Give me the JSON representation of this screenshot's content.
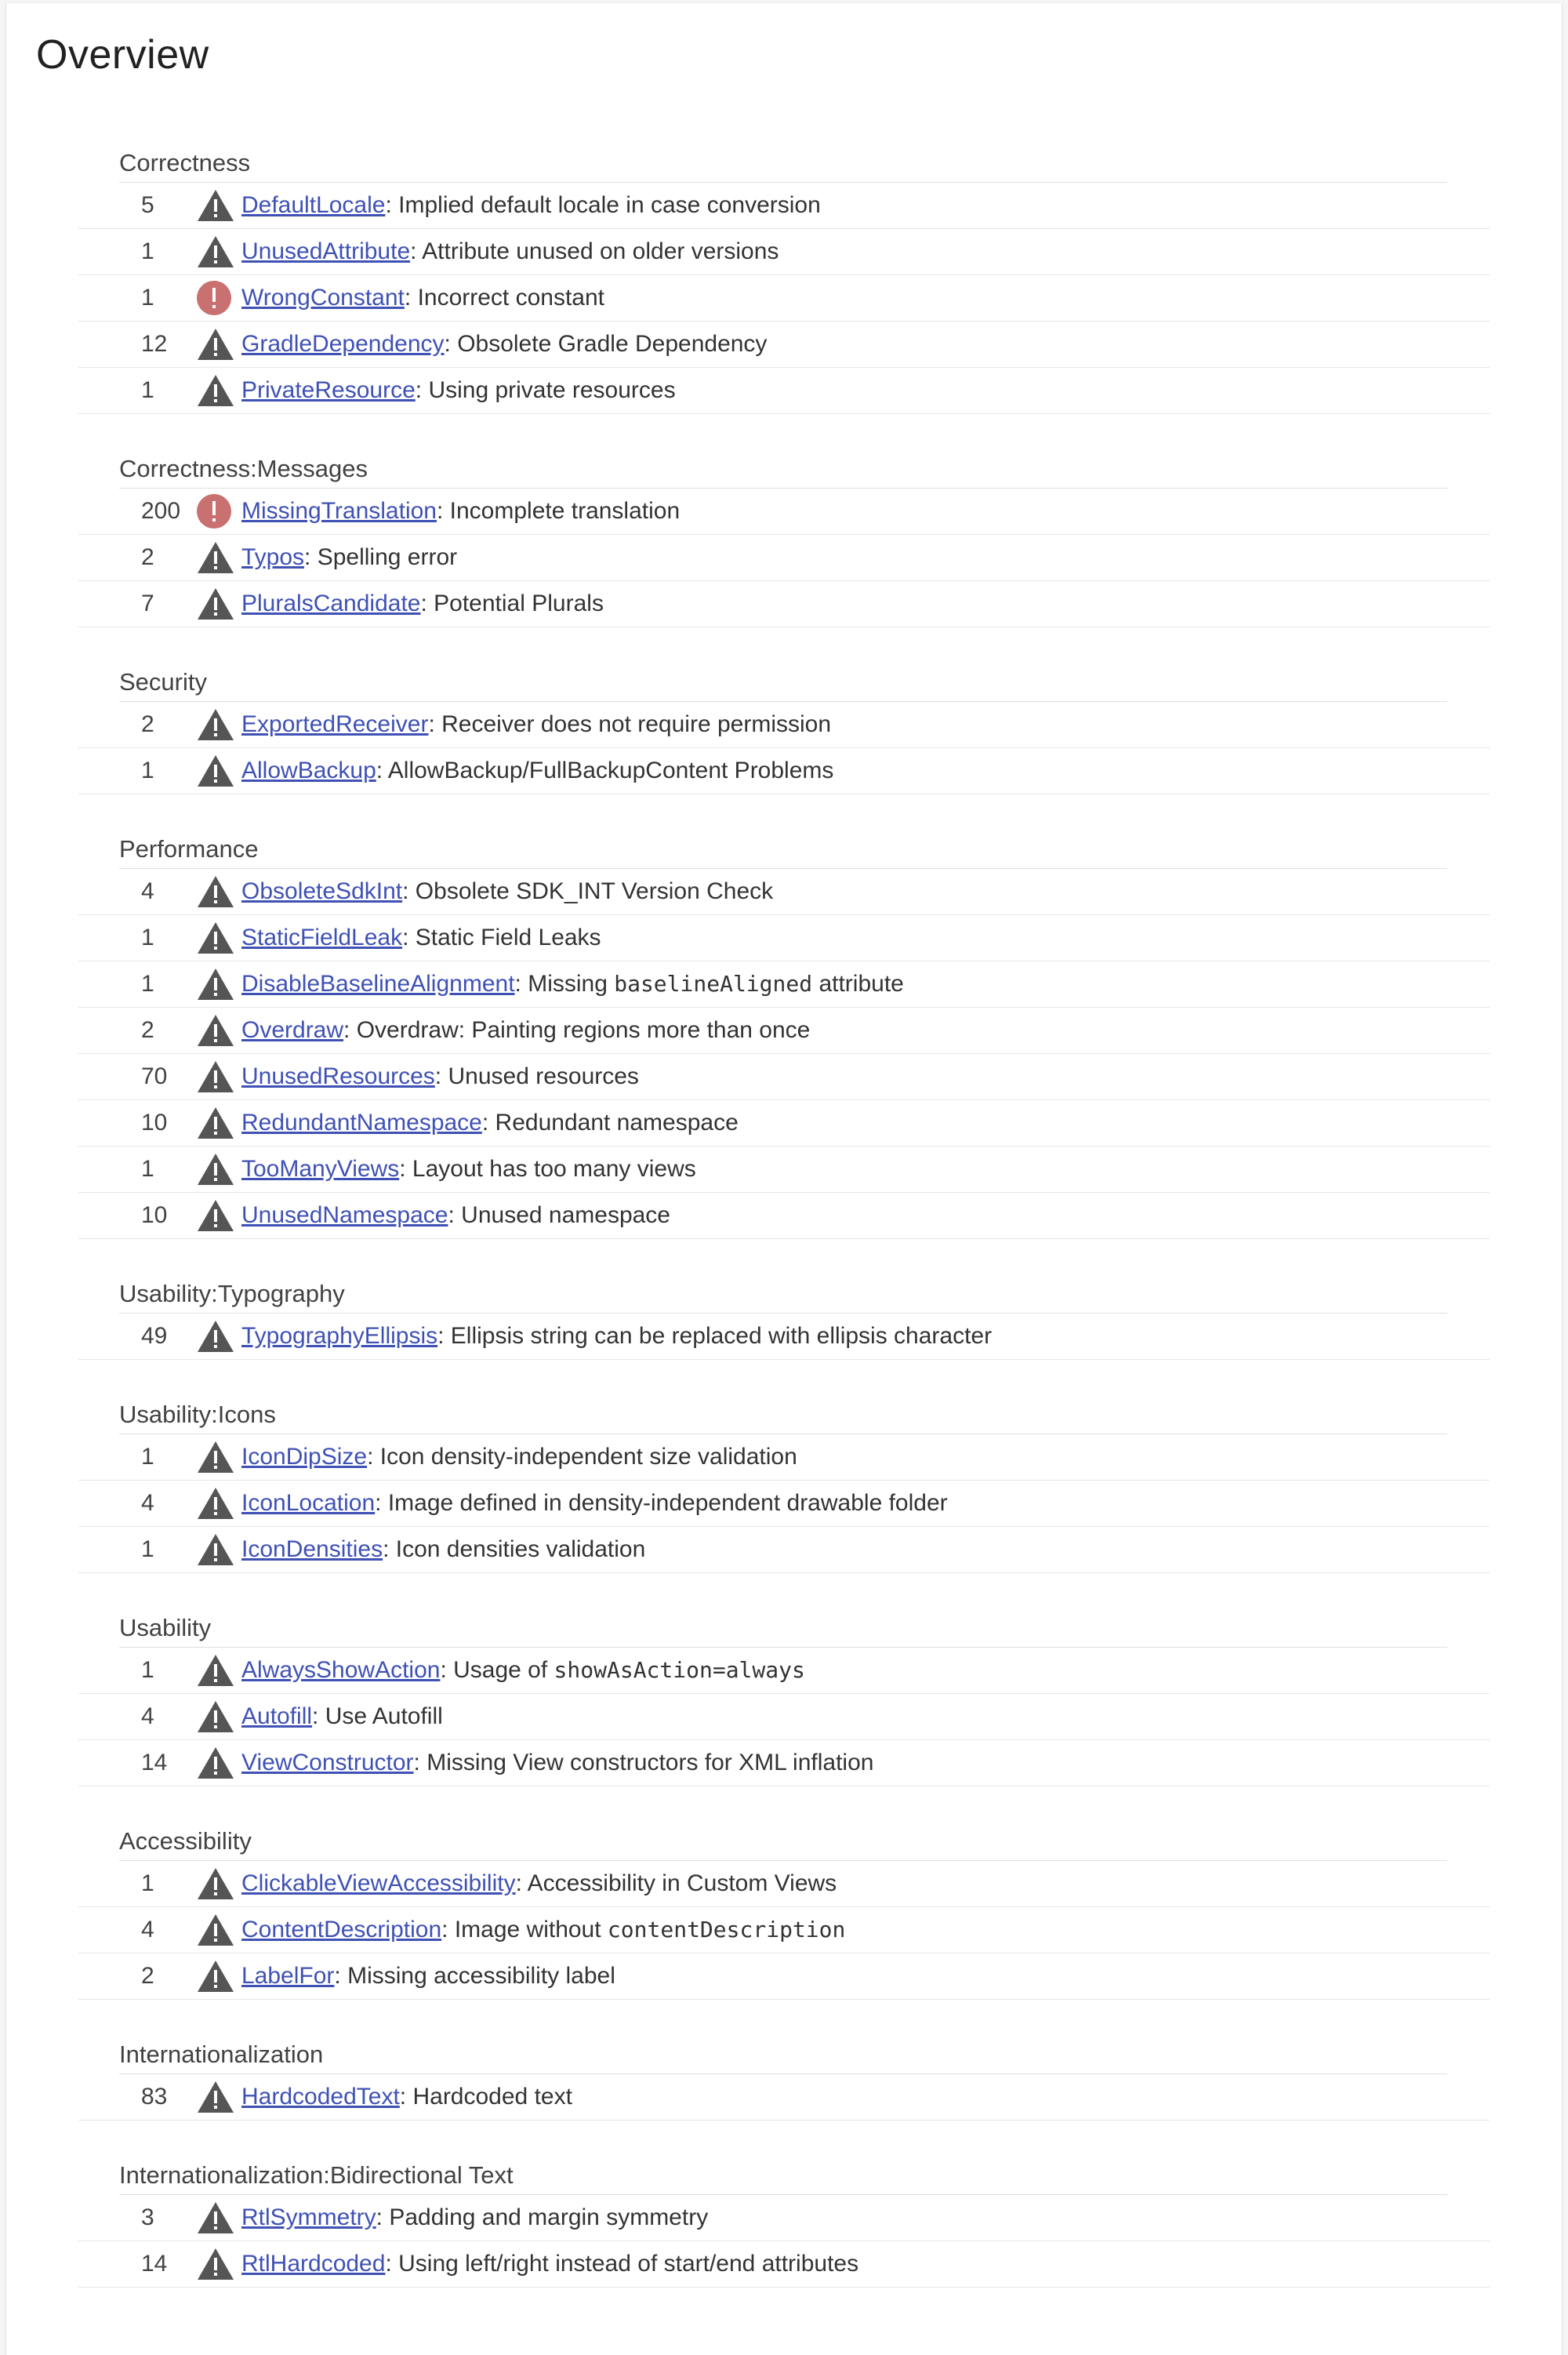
{
  "page": {
    "title": "Overview"
  },
  "sections": [
    {
      "title": "Correctness",
      "items": [
        {
          "count": "5",
          "severity": "warning",
          "id": "DefaultLocale",
          "description": "Implied default locale in case conversion"
        },
        {
          "count": "1",
          "severity": "warning",
          "id": "UnusedAttribute",
          "description": "Attribute unused on older versions"
        },
        {
          "count": "1",
          "severity": "error",
          "id": "WrongConstant",
          "description": "Incorrect constant"
        },
        {
          "count": "12",
          "severity": "warning",
          "id": "GradleDependency",
          "description": "Obsolete Gradle Dependency"
        },
        {
          "count": "1",
          "severity": "warning",
          "id": "PrivateResource",
          "description": "Using private resources"
        }
      ]
    },
    {
      "title": "Correctness:Messages",
      "items": [
        {
          "count": "200",
          "severity": "error",
          "id": "MissingTranslation",
          "description": "Incomplete translation"
        },
        {
          "count": "2",
          "severity": "warning",
          "id": "Typos",
          "description": "Spelling error"
        },
        {
          "count": "7",
          "severity": "warning",
          "id": "PluralsCandidate",
          "description": "Potential Plurals"
        }
      ]
    },
    {
      "title": "Security",
      "items": [
        {
          "count": "2",
          "severity": "warning",
          "id": "ExportedReceiver",
          "description": "Receiver does not require permission"
        },
        {
          "count": "1",
          "severity": "warning",
          "id": "AllowBackup",
          "description": "AllowBackup/FullBackupContent Problems"
        }
      ]
    },
    {
      "title": "Performance",
      "items": [
        {
          "count": "4",
          "severity": "warning",
          "id": "ObsoleteSdkInt",
          "description": "Obsolete SDK_INT Version Check"
        },
        {
          "count": "1",
          "severity": "warning",
          "id": "StaticFieldLeak",
          "description": "Static Field Leaks"
        },
        {
          "count": "1",
          "severity": "warning",
          "id": "DisableBaselineAlignment",
          "description": "Missing ",
          "code": "baselineAligned",
          "suffix": " attribute"
        },
        {
          "count": "2",
          "severity": "warning",
          "id": "Overdraw",
          "description": "Overdraw: Painting regions more than once"
        },
        {
          "count": "70",
          "severity": "warning",
          "id": "UnusedResources",
          "description": "Unused resources"
        },
        {
          "count": "10",
          "severity": "warning",
          "id": "RedundantNamespace",
          "description": "Redundant namespace"
        },
        {
          "count": "1",
          "severity": "warning",
          "id": "TooManyViews",
          "description": "Layout has too many views"
        },
        {
          "count": "10",
          "severity": "warning",
          "id": "UnusedNamespace",
          "description": "Unused namespace"
        }
      ]
    },
    {
      "title": "Usability:Typography",
      "items": [
        {
          "count": "49",
          "severity": "warning",
          "id": "TypographyEllipsis",
          "description": "Ellipsis string can be replaced with ellipsis character"
        }
      ]
    },
    {
      "title": "Usability:Icons",
      "items": [
        {
          "count": "1",
          "severity": "warning",
          "id": "IconDipSize",
          "description": "Icon density-independent size validation"
        },
        {
          "count": "4",
          "severity": "warning",
          "id": "IconLocation",
          "description": "Image defined in density-independent drawable folder"
        },
        {
          "count": "1",
          "severity": "warning",
          "id": "IconDensities",
          "description": "Icon densities validation"
        }
      ]
    },
    {
      "title": "Usability",
      "items": [
        {
          "count": "1",
          "severity": "warning",
          "id": "AlwaysShowAction",
          "description": "Usage of ",
          "code": "showAsAction=always",
          "suffix": ""
        },
        {
          "count": "4",
          "severity": "warning",
          "id": "Autofill",
          "description": "Use Autofill"
        },
        {
          "count": "14",
          "severity": "warning",
          "id": "ViewConstructor",
          "description": "Missing View constructors for XML inflation"
        }
      ]
    },
    {
      "title": "Accessibility",
      "items": [
        {
          "count": "1",
          "severity": "warning",
          "id": "ClickableViewAccessibility",
          "description": "Accessibility in Custom Views"
        },
        {
          "count": "4",
          "severity": "warning",
          "id": "ContentDescription",
          "description": "Image without ",
          "code": "contentDescription",
          "suffix": ""
        },
        {
          "count": "2",
          "severity": "warning",
          "id": "LabelFor",
          "description": "Missing accessibility label"
        }
      ]
    },
    {
      "title": "Internationalization",
      "items": [
        {
          "count": "83",
          "severity": "warning",
          "id": "HardcodedText",
          "description": "Hardcoded text"
        }
      ]
    },
    {
      "title": "Internationalization:Bidirectional Text",
      "items": [
        {
          "count": "3",
          "severity": "warning",
          "id": "RtlSymmetry",
          "description": "Padding and margin symmetry"
        },
        {
          "count": "14",
          "severity": "warning",
          "id": "RtlHardcoded",
          "description": "Using left/right instead of start/end attributes"
        }
      ]
    }
  ],
  "colors": {
    "warning": "#555555",
    "error": "#c97070",
    "link": "#3f51b5"
  },
  "icons": {
    "warning": "warning-triangle-icon",
    "error": "error-circle-icon"
  }
}
